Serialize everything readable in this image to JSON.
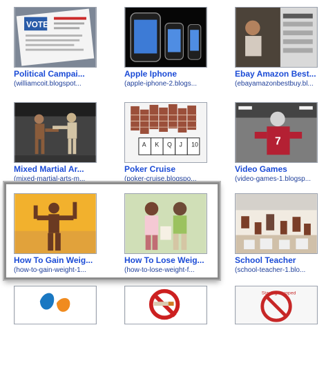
{
  "colors": {
    "title": "#1b4bd6",
    "url": "#1f3f9a",
    "border": "#9ca3af",
    "selection": "#8c8c8c"
  },
  "grid": {
    "items": [
      {
        "id": "political-campaign",
        "title": "Political Campai...",
        "url": "(williamcoit.blogspot...",
        "icon": "political-campaign-thumbnail"
      },
      {
        "id": "apple-iphone",
        "title": "Apple Iphone",
        "url": "(apple-iphone-2.blogs...",
        "icon": "apple-iphone-thumbnail"
      },
      {
        "id": "ebay-amazon-best",
        "title": "Ebay Amazon Best...",
        "url": "(ebayamazonbestbuy.bl...",
        "icon": "ebay-amazon-thumbnail"
      },
      {
        "id": "mixed-martial-arts",
        "title": "Mixed Martial Ar...",
        "url": "(mixed-martial-arts-m...",
        "icon": "mixed-martial-arts-thumbnail"
      },
      {
        "id": "poker-cruise",
        "title": "Poker Cruise",
        "url": "(poker-cruise.blogspo...",
        "icon": "poker-cruise-thumbnail"
      },
      {
        "id": "video-games",
        "title": "Video Games",
        "url": "(video-games-1.blogsp...",
        "icon": "video-games-thumbnail"
      },
      {
        "id": "how-to-gain-weight",
        "title": "How To Gain Weig...",
        "url": "(how-to-gain-weight-1...",
        "icon": "gain-weight-thumbnail"
      },
      {
        "id": "how-to-lose-weight",
        "title": "How To Lose Weig...",
        "url": "(how-to-lose-weight-f...",
        "icon": "lose-weight-thumbnail"
      },
      {
        "id": "school-teacher",
        "title": "School Teacher",
        "url": "(school-teacher-1.blo...",
        "icon": "school-teacher-thumbnail"
      },
      {
        "id": "partial-1",
        "title": "",
        "url": "",
        "icon": "partial-brand-thumbnail"
      },
      {
        "id": "partial-2",
        "title": "",
        "url": "",
        "icon": "partial-no-smoking-thumbnail"
      },
      {
        "id": "partial-3",
        "title": "",
        "url": "",
        "icon": "partial-stop-smoking-thumbnail"
      }
    ],
    "partial_labels": {
      "stop": "Staying Stopped"
    }
  }
}
